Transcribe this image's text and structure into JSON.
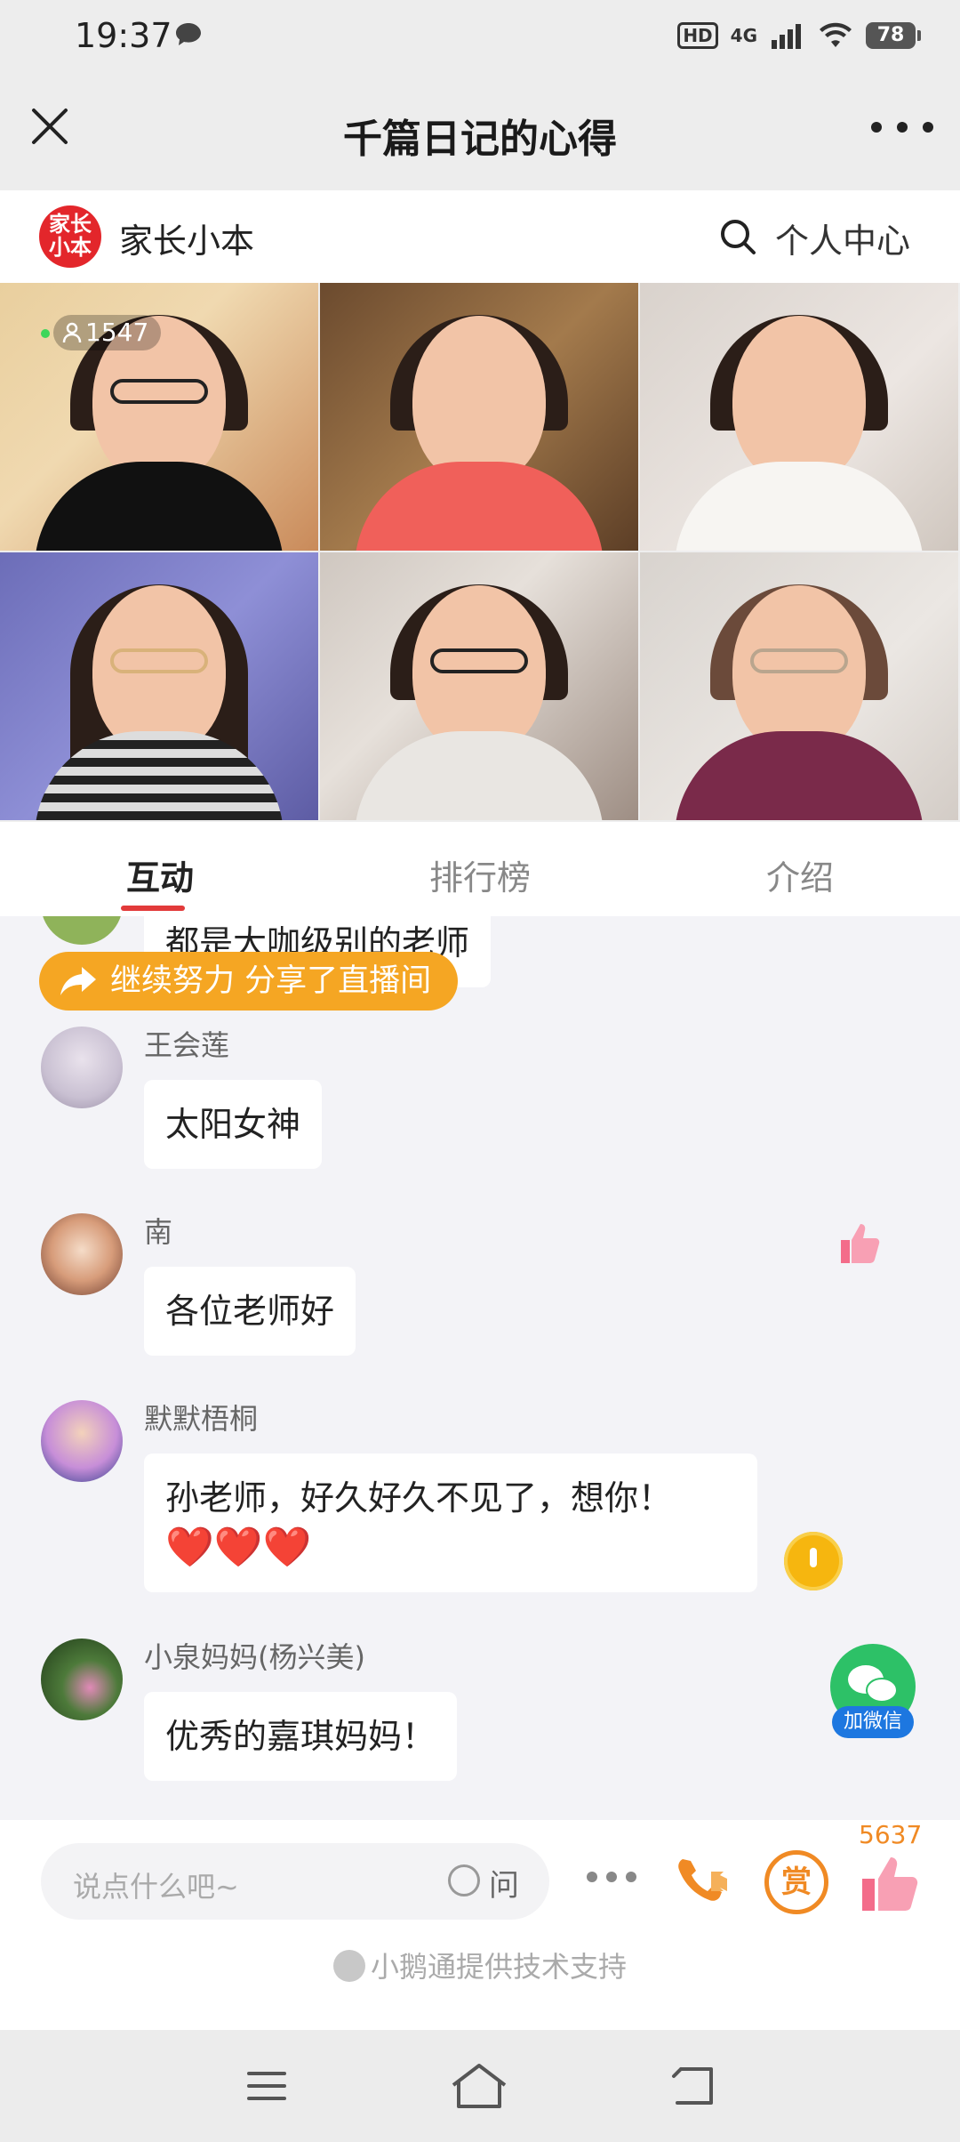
{
  "status_bar": {
    "time": "19:37",
    "hd": "HD",
    "network": "4G",
    "battery": "78"
  },
  "header": {
    "title": "千篇日记的心得"
  },
  "brand": {
    "logo_text": "家长小本",
    "name": "家长小本",
    "personal_center": "个人中心"
  },
  "live": {
    "viewer_count": "1547"
  },
  "tabs": [
    {
      "label": "互动",
      "active": true
    },
    {
      "label": "排行榜",
      "active": false
    },
    {
      "label": "介绍",
      "active": false
    }
  ],
  "chat": {
    "partial_bubble": "都是大咖级别的老师",
    "share_banner": "继续努力 分享了直播间",
    "messages": [
      {
        "sender": "王会莲",
        "text": "太阳女神"
      },
      {
        "sender": "南",
        "text": "各位老师好"
      },
      {
        "sender": "默默梧桐",
        "text": "孙老师，好久好久不见了，想你！",
        "text2": "❤️❤️❤️"
      },
      {
        "sender": "小泉妈妈(杨兴美)",
        "text": "优秀的嘉琪妈妈！"
      }
    ],
    "wechat_label": "加微信"
  },
  "bottom": {
    "input_placeholder": "说点什么吧~",
    "ask_label": "问",
    "reward_label": "赏",
    "like_count": "5637",
    "support_text": "小鹅通提供技术支持"
  },
  "colors": {
    "accent": "#e23a3a",
    "orange": "#f5a623",
    "wechat_green": "#2dc167"
  },
  "icons": [
    "chat-bubble-icon",
    "close-icon",
    "more-icon",
    "search-icon",
    "viewer-icon",
    "share-icon",
    "thumbs-up-icon",
    "coin-icon",
    "wechat-icon",
    "phone-video-icon",
    "menu-icon",
    "home-icon",
    "back-icon"
  ]
}
